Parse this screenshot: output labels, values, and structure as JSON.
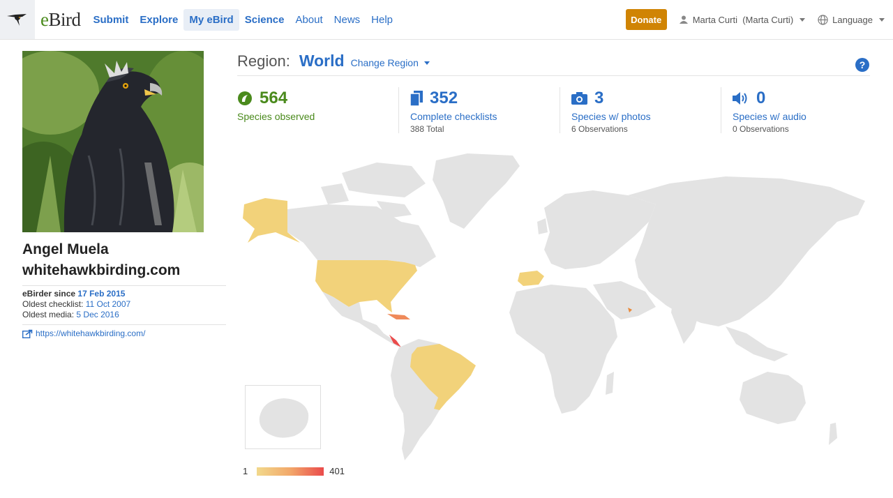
{
  "header": {
    "logo_text_e": "e",
    "logo_text_bird": "Bird",
    "nav": [
      {
        "label": "Submit",
        "bold": true,
        "active": false
      },
      {
        "label": "Explore",
        "bold": true,
        "active": false
      },
      {
        "label": "My eBird",
        "bold": true,
        "active": true
      },
      {
        "label": "Science",
        "bold": true,
        "active": false
      },
      {
        "label": "About",
        "bold": false,
        "active": false
      },
      {
        "label": "News",
        "bold": false,
        "active": false
      },
      {
        "label": "Help",
        "bold": false,
        "active": false
      }
    ],
    "donate_label": "Donate",
    "user_label": "Marta Curti  (Marta Curti)",
    "language_label": "Language"
  },
  "profile": {
    "name_line1": "Angel Muela",
    "name_line2": "whitehawkbirding.com",
    "since_label": "eBirder since",
    "since_value": "17 Feb 2015",
    "oldest_checklist_label": "Oldest checklist:",
    "oldest_checklist_value": "11 Oct 2007",
    "oldest_media_label": "Oldest media:",
    "oldest_media_value": "5 Dec 2016",
    "website": "https://whitehawkbirding.com/"
  },
  "region": {
    "label": "Region:",
    "value": "World",
    "change_label": "Change Region",
    "help_label": "?"
  },
  "stats": [
    {
      "value": "564",
      "label": "Species observed",
      "sub": "",
      "icon": "species-icon"
    },
    {
      "value": "352",
      "label": "Complete checklists",
      "sub": "388 Total",
      "icon": "checklist-icon"
    },
    {
      "value": "3",
      "label": "Species w/ photos",
      "sub": "6 Observations",
      "icon": "camera-icon"
    },
    {
      "value": "0",
      "label": "Species w/ audio",
      "sub": "0 Observations",
      "icon": "audio-icon"
    }
  ],
  "legend": {
    "min": "1",
    "max": "401"
  },
  "colors": {
    "accent": "#2a6ec6",
    "green": "#4a8a1c",
    "donate": "#d08404",
    "land": "#e3e3e3",
    "low": "#f2d98c",
    "mid": "#f2a86a",
    "high": "#ea4b4b"
  }
}
